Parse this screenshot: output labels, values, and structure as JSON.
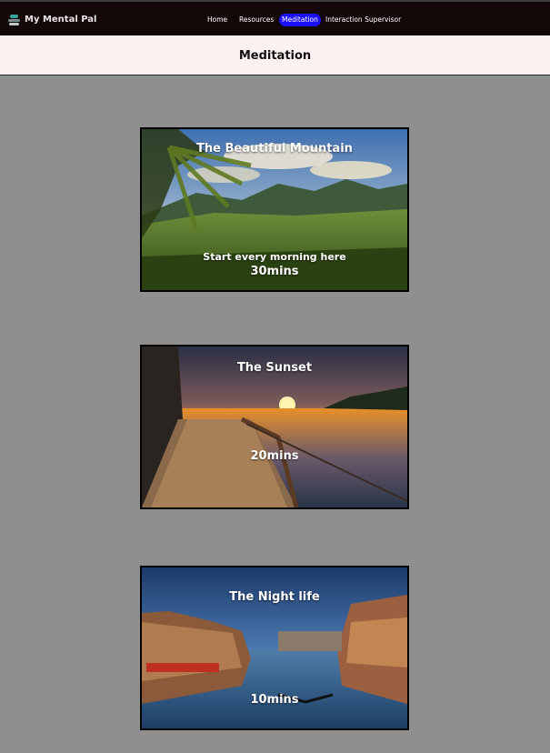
{
  "app": {
    "brand": "My Mental Pal",
    "brand_icon": "stones-stack-icon"
  },
  "nav": {
    "items": [
      {
        "label": "Home",
        "active": false
      },
      {
        "label": "Resources",
        "active": false
      },
      {
        "label": "Meditation",
        "active": true
      },
      {
        "label": "Interaction Supervisor",
        "active": false
      }
    ],
    "active_color": "#1a10ff"
  },
  "page": {
    "title": "Meditation"
  },
  "cards": [
    {
      "title": "The  Beautiful Mountain",
      "subtitle": "Start every morning here",
      "duration": "30mins",
      "image": "mountain-landscape"
    },
    {
      "title": "The Sunset",
      "subtitle": "",
      "duration": "20mins",
      "image": "sunset-boardwalk"
    },
    {
      "title": "The Night life",
      "subtitle": "",
      "duration": "10mins",
      "image": "venice-night-canal"
    }
  ],
  "colors": {
    "navbar_bg": "#130708",
    "titlebar_bg": "#fdf1f1",
    "page_bg": "#8f8f8f"
  }
}
